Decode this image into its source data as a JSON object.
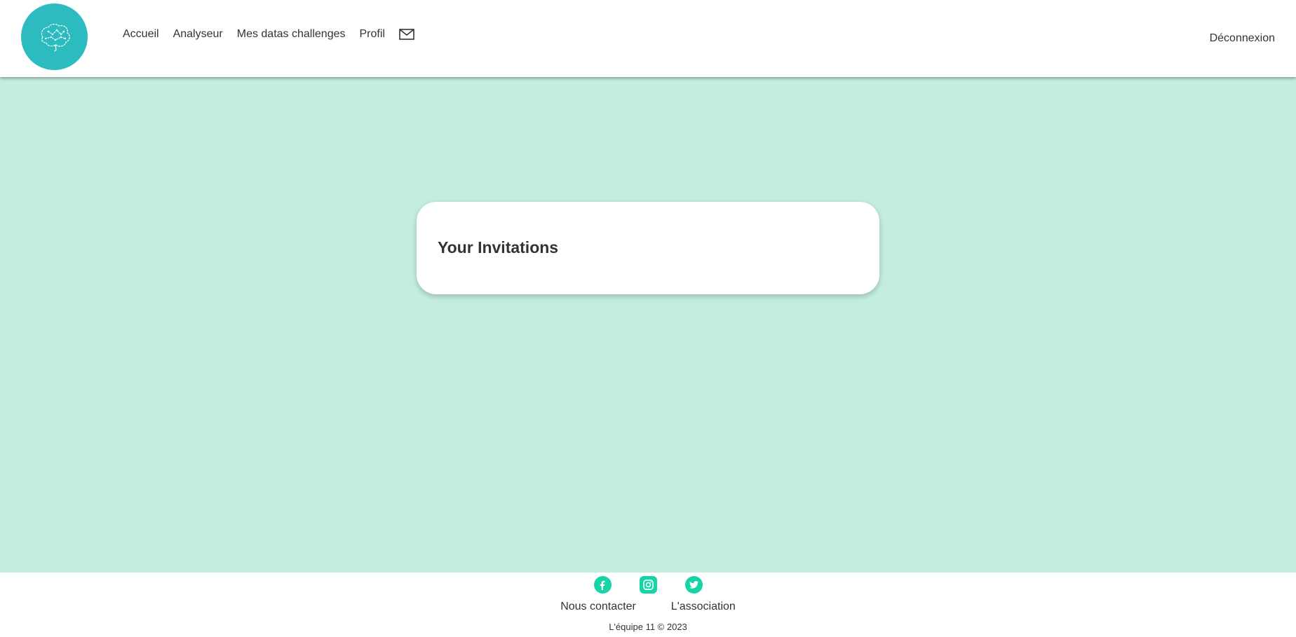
{
  "header": {
    "logo_icon": "brain-icon",
    "nav": {
      "home": "Accueil",
      "analyzer": "Analyseur",
      "challenges": "Mes datas challenges",
      "profile": "Profil",
      "messages_icon": "mail-icon"
    },
    "logout": "Déconnexion"
  },
  "main": {
    "card_title": "Your Invitations"
  },
  "footer": {
    "social_icons": [
      "facebook-icon",
      "instagram-icon",
      "twitter-icon"
    ],
    "links": {
      "contact": "Nous contacter",
      "association": "L'association"
    },
    "copyright": "L'équipe 11 © 2023"
  },
  "colors": {
    "logo_bg": "#2cbcbf",
    "main_bg": "#c4ede2",
    "social_accent": "#17d4a8"
  }
}
